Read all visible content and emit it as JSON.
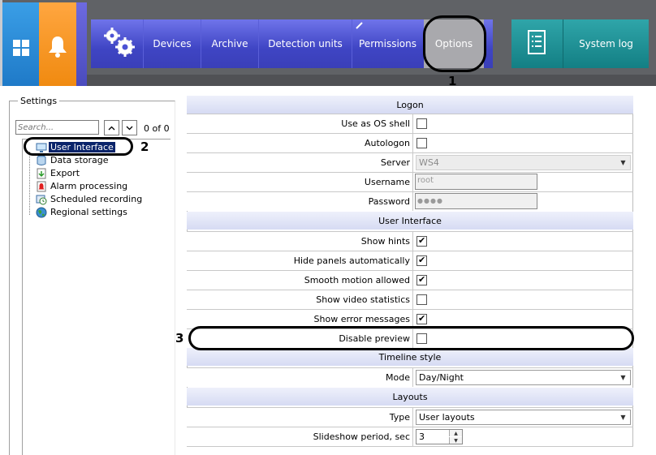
{
  "toolbar": {
    "tabs": [
      {
        "label": "Devices"
      },
      {
        "label": "Archive"
      },
      {
        "label": "Detection units"
      },
      {
        "label": "Permissions"
      },
      {
        "label": "Options"
      }
    ],
    "system_log_label": "System log",
    "colors": {
      "windows_tile": "#2389d8",
      "alarm_tile": "#f99220",
      "nav_blue": "#4c52d4",
      "active_tab": "#a9a9ad",
      "syslog_teal": "#1a8f94"
    }
  },
  "callouts": {
    "n1": "1",
    "n2": "2",
    "n3": "3"
  },
  "settings": {
    "title": "Settings",
    "search_placeholder": "Search...",
    "search_count": "0 of 0",
    "tree": [
      {
        "label": "User Interface",
        "icon": "monitor-icon",
        "selected": true
      },
      {
        "label": "Data storage",
        "icon": "database-icon"
      },
      {
        "label": "Export",
        "icon": "export-icon"
      },
      {
        "label": "Alarm processing",
        "icon": "alarm-icon"
      },
      {
        "label": "Scheduled recording",
        "icon": "schedule-icon"
      },
      {
        "label": "Regional settings",
        "icon": "globe-icon"
      }
    ]
  },
  "grid": {
    "sections": {
      "logon": "Logon",
      "user_interface": "User Interface",
      "timeline": "Timeline style",
      "layouts": "Layouts"
    },
    "logon": {
      "use_os_shell": {
        "label": "Use as OS shell",
        "checked": false
      },
      "autologon": {
        "label": "Autologon",
        "checked": false
      },
      "server": {
        "label": "Server",
        "value": "WS4"
      },
      "username": {
        "label": "Username",
        "value": "root"
      },
      "password": {
        "label": "Password",
        "value": "●●●●"
      }
    },
    "ui": {
      "show_hints": {
        "label": "Show hints",
        "checked": true
      },
      "hide_panels": {
        "label": "Hide panels automatically",
        "checked": true
      },
      "smooth_motion": {
        "label": "Smooth motion allowed",
        "checked": true
      },
      "video_stats": {
        "label": "Show video statistics",
        "checked": false
      },
      "error_messages": {
        "label": "Show error messages",
        "checked": true
      },
      "disable_preview": {
        "label": "Disable preview",
        "checked": false
      }
    },
    "timeline": {
      "mode": {
        "label": "Mode",
        "value": "Day/Night"
      }
    },
    "layouts": {
      "type": {
        "label": "Type",
        "value": "User layouts"
      },
      "slideshow": {
        "label": "Slideshow period, sec",
        "value": "3"
      }
    },
    "check_mark": "✔"
  }
}
